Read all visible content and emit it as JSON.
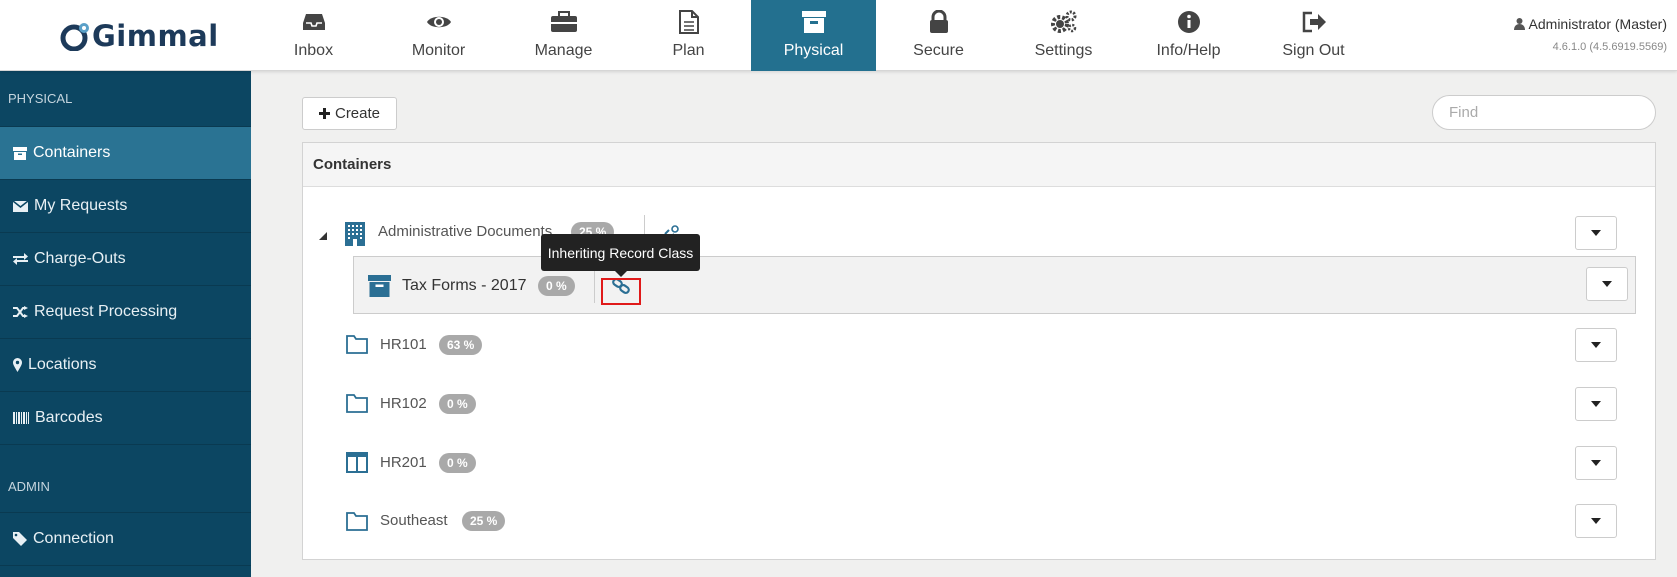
{
  "header": {
    "logo_text": "Gimmal",
    "nav": [
      {
        "label": "Inbox",
        "icon": "inbox-icon"
      },
      {
        "label": "Monitor",
        "icon": "eye-icon"
      },
      {
        "label": "Manage",
        "icon": "briefcase-icon"
      },
      {
        "label": "Plan",
        "icon": "document-icon"
      },
      {
        "label": "Physical",
        "icon": "archive-box-icon",
        "active": true
      },
      {
        "label": "Secure",
        "icon": "lock-icon"
      },
      {
        "label": "Settings",
        "icon": "gears-icon"
      },
      {
        "label": "Info/Help",
        "icon": "info-icon"
      },
      {
        "label": "Sign Out",
        "icon": "sign-out-icon"
      }
    ],
    "user": "Administrator (Master)",
    "version": "4.6.1.0 (4.5.6919.5569)"
  },
  "sidebar": {
    "section_physical": "PHYSICAL",
    "items": [
      {
        "label": "Containers",
        "icon": "archive-icon",
        "active": true
      },
      {
        "label": "My Requests",
        "icon": "envelope-icon"
      },
      {
        "label": "Charge-Outs",
        "icon": "exchange-icon"
      },
      {
        "label": "Request Processing",
        "icon": "shuffle-icon"
      },
      {
        "label": "Locations",
        "icon": "map-marker-icon"
      },
      {
        "label": "Barcodes",
        "icon": "barcode-icon"
      }
    ],
    "section_admin": "ADMIN",
    "admin_items": [
      {
        "label": "Connection",
        "icon": "tag-icon"
      }
    ]
  },
  "toolbar": {
    "create_label": "Create",
    "find_placeholder": "Find"
  },
  "panel": {
    "title": "Containers",
    "rows": [
      {
        "label": "Administrative Documents",
        "percent": "25 %",
        "icon": "building-icon"
      },
      {
        "label": "Tax Forms - 2017",
        "percent": "0 %",
        "icon": "archive-box-icon"
      },
      {
        "label": "HR101",
        "percent": "63 %",
        "icon": "folder-icon"
      },
      {
        "label": "HR102",
        "percent": "0 %",
        "icon": "folder-icon"
      },
      {
        "label": "HR201",
        "percent": "0 %",
        "icon": "columns-icon"
      },
      {
        "label": "Southeast",
        "percent": "25 %",
        "icon": "folder-icon"
      }
    ]
  },
  "tooltip": {
    "text": "Inheriting Record Class"
  },
  "colors": {
    "accent": "#23708f",
    "sidebar": "#0c4662",
    "sidebar_active": "#2a7393",
    "icon_blue": "#2b6f94",
    "highlight": "#e01a1a"
  }
}
